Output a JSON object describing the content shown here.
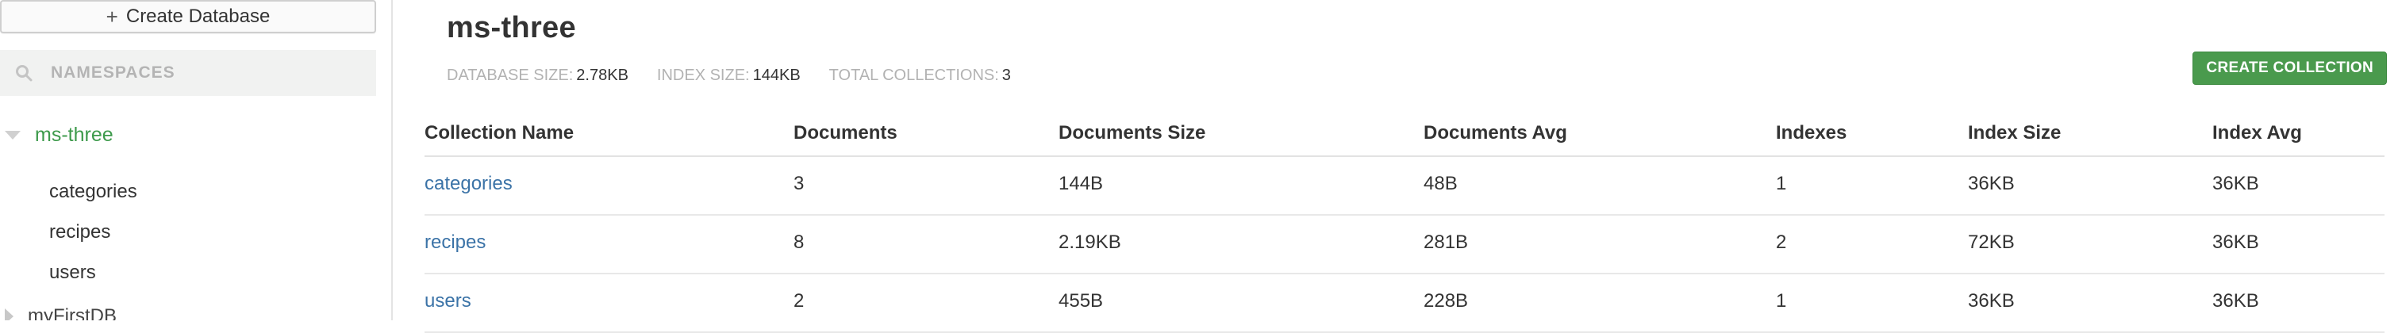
{
  "sidebar": {
    "create_db_label": "Create Database",
    "namespaces_label": "NAMESPACES",
    "active_db": "ms-three",
    "collections": [
      "categories",
      "recipes",
      "users"
    ],
    "other_db": "myFirstDB"
  },
  "main": {
    "title": "ms-three",
    "stats": [
      {
        "label": "DATABASE SIZE:",
        "value": "2.78KB"
      },
      {
        "label": "INDEX SIZE:",
        "value": "144KB"
      },
      {
        "label": "TOTAL COLLECTIONS:",
        "value": "3"
      }
    ],
    "create_collection_label": "CREATE COLLECTION",
    "table": {
      "columns": [
        "Collection Name",
        "Documents",
        "Documents Size",
        "Documents Avg",
        "Indexes",
        "Index Size",
        "Index Avg"
      ],
      "rows": [
        [
          "categories",
          "3",
          "144B",
          "48B",
          "1",
          "36KB",
          "36KB"
        ],
        [
          "recipes",
          "8",
          "2.19KB",
          "281B",
          "2",
          "72KB",
          "36KB"
        ],
        [
          "users",
          "2",
          "455B",
          "228B",
          "1",
          "36KB",
          "36KB"
        ]
      ]
    }
  },
  "colors": {
    "accent_green": "#3d9a4b",
    "button_green": "#4a9a4d",
    "link_blue": "#3b73a7"
  }
}
